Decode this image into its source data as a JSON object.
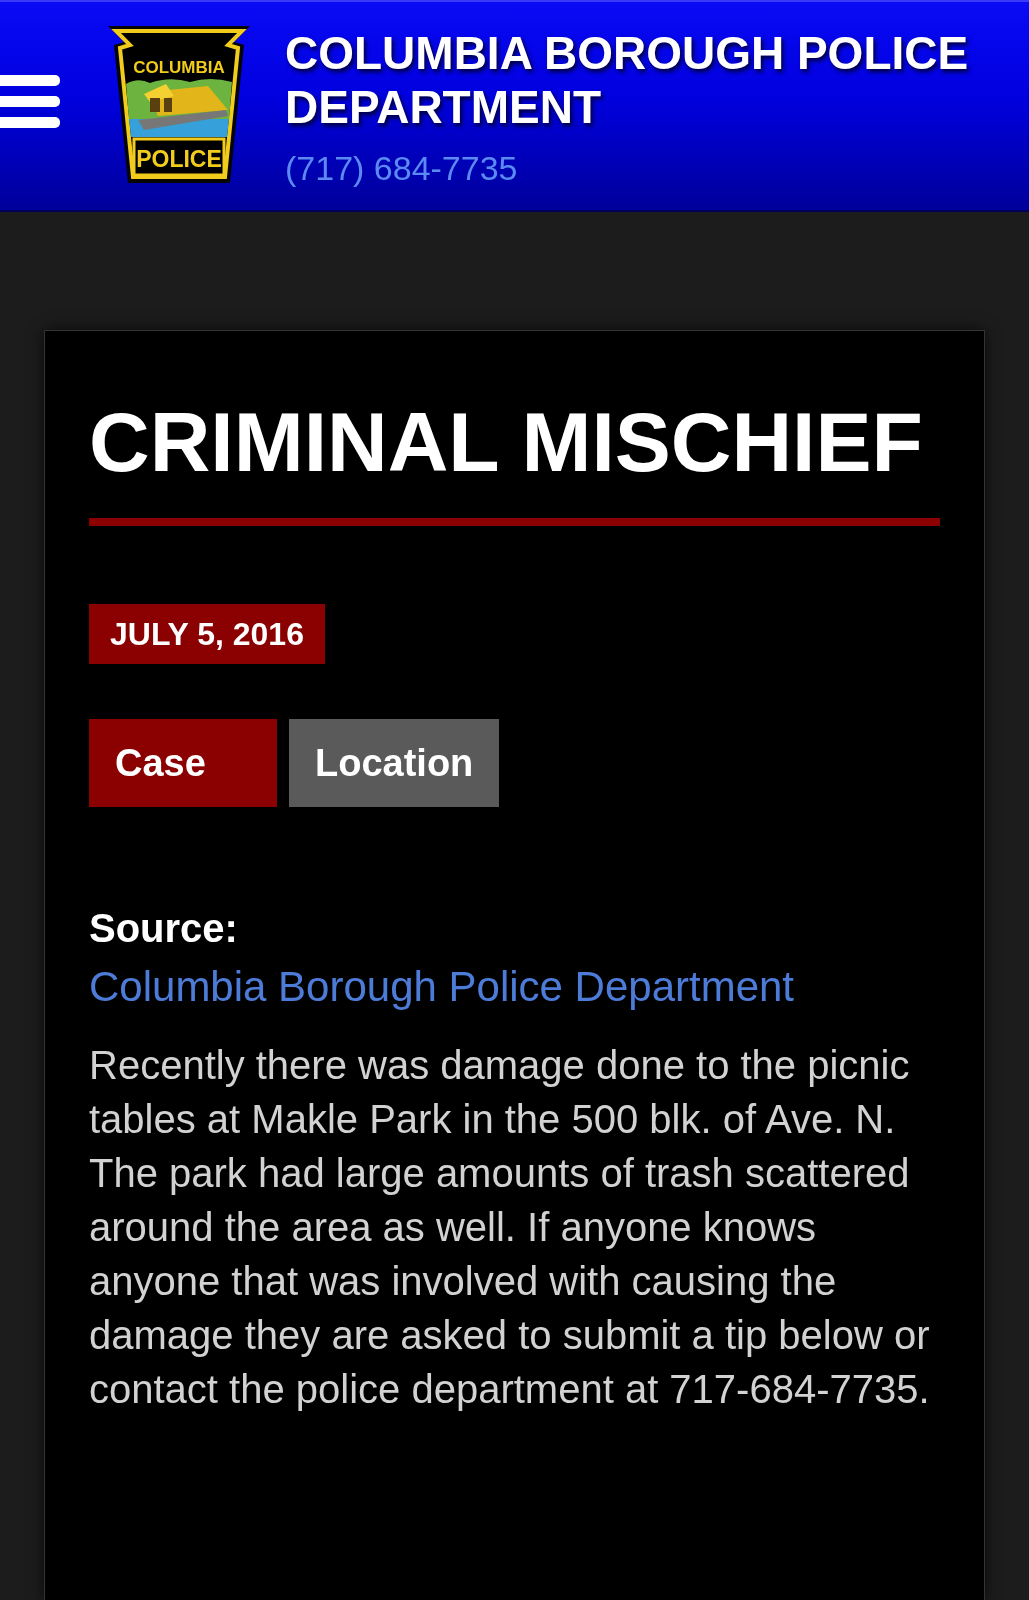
{
  "header": {
    "logo": {
      "top_text": "COLUMBIA",
      "bottom_text": "POLICE"
    },
    "title": "COLUMBIA BOROUGH POLICE DEPARTMENT",
    "phone": "(717) 684-7735"
  },
  "article": {
    "title": "CRIMINAL MISCHIEF",
    "date": "JULY 5, 2016",
    "tabs": [
      {
        "label": "Case",
        "selected": true
      },
      {
        "label": "Location",
        "selected": false
      }
    ],
    "source_label": "Source:",
    "source_link": "Columbia Borough Police Department",
    "body": "Recently there was damage done to the picnic tables at Makle Park in the 500 blk. of Ave. N. The park had large amounts of trash scattered around the area as well. If anyone knows anyone that was involved with causing the damage they are asked to submit a tip below or contact the police department at 717-684-7735."
  }
}
